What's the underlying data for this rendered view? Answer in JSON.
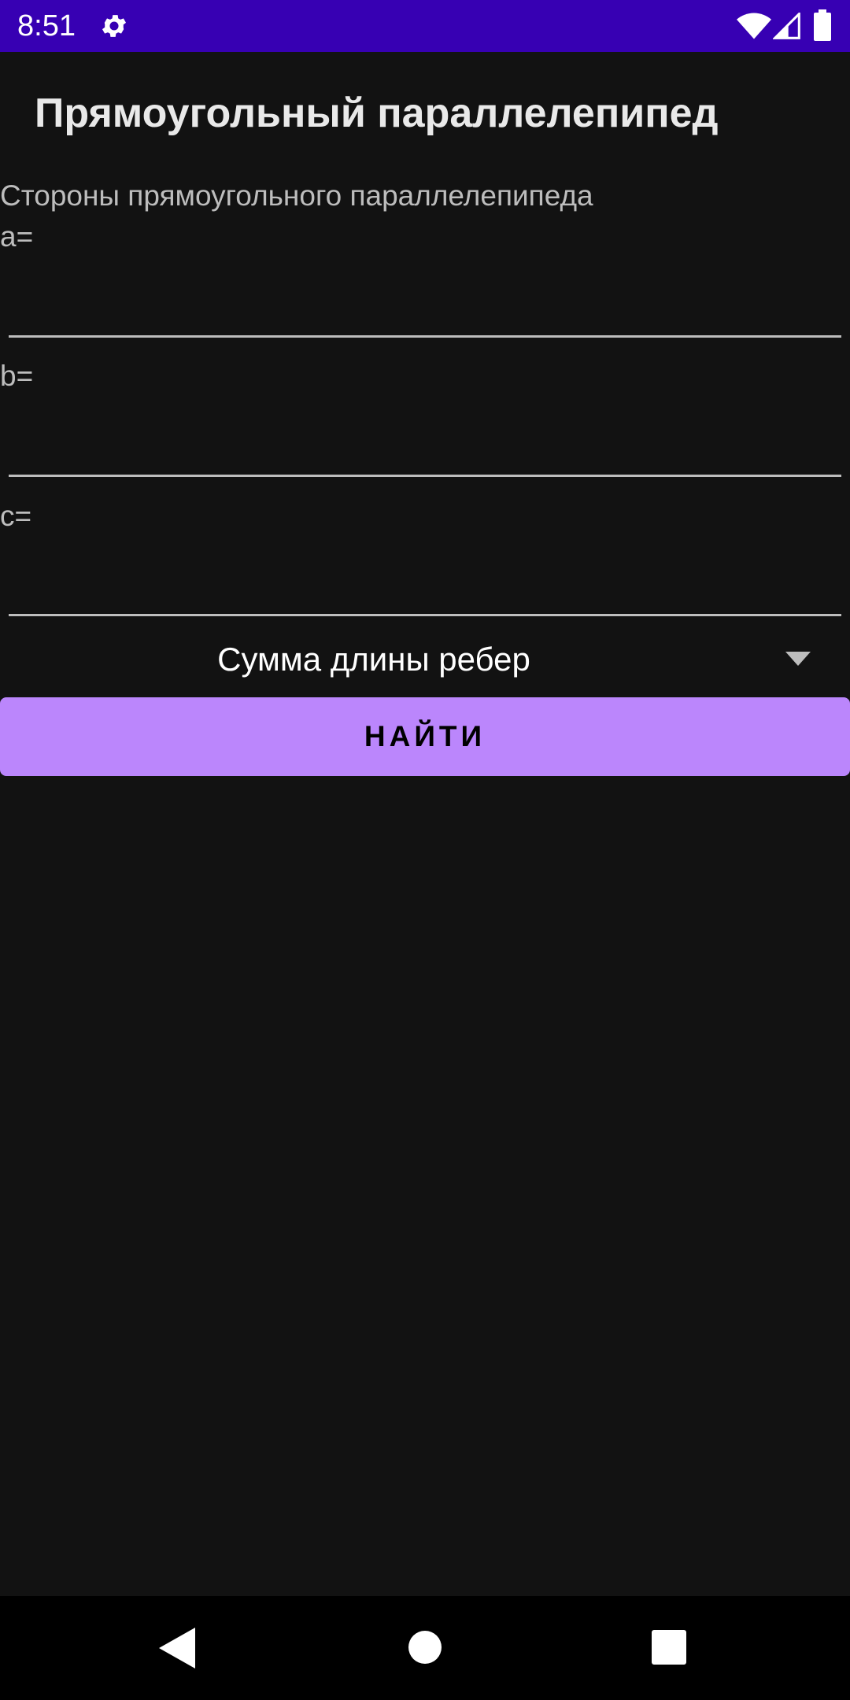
{
  "status_bar": {
    "time": "8:51",
    "icons": [
      "gear-icon",
      "wifi-icon",
      "signal-icon",
      "battery-icon"
    ],
    "color": "#3700b3"
  },
  "app": {
    "title": "Прямоугольный параллелепипед",
    "subtitle": "Стороны прямоугольного параллелепипеда"
  },
  "fields": {
    "a": {
      "label": "a=",
      "value": ""
    },
    "b": {
      "label": "b=",
      "value": ""
    },
    "c": {
      "label": "c=",
      "value": ""
    }
  },
  "spinner": {
    "selected": "Сумма длины ребер",
    "icon": "dropdown-arrow-icon"
  },
  "button": {
    "label": "НАЙТИ",
    "color": "#bb86fc"
  },
  "nav_bar": {
    "icons": [
      "back-icon",
      "home-icon",
      "recents-icon"
    ]
  },
  "theme": {
    "background": "#121212",
    "text": "#bdbdbd"
  }
}
